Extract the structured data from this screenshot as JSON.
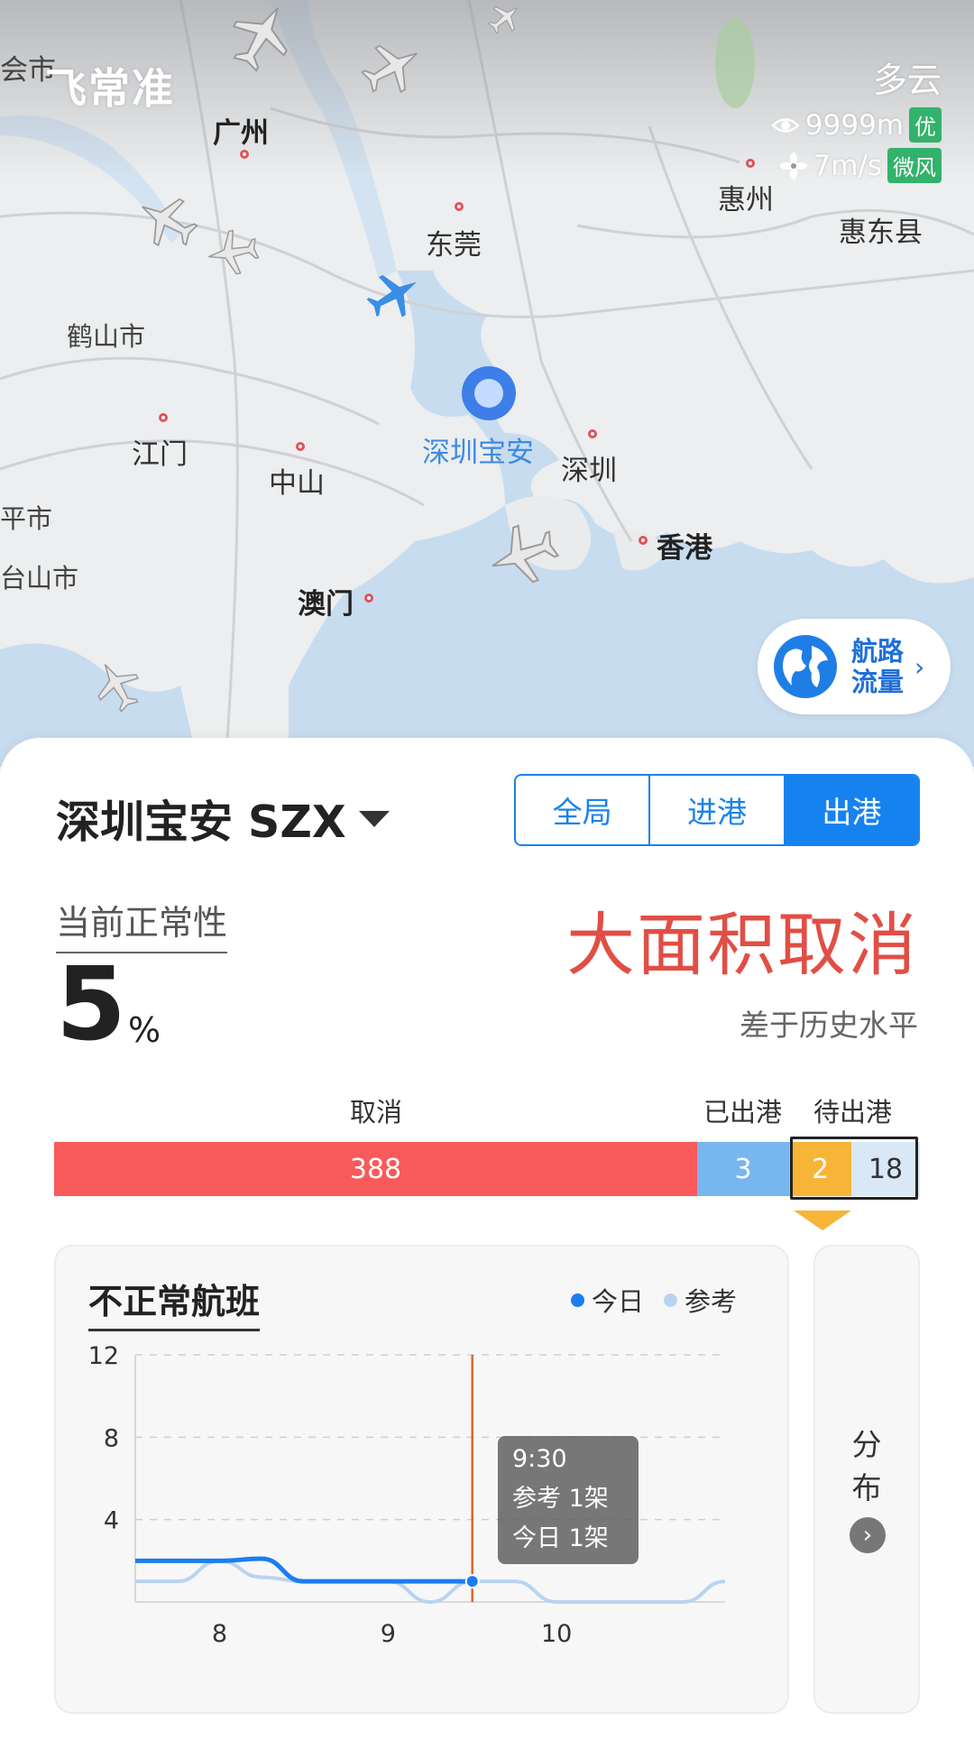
{
  "app": {
    "logo": "飞常准"
  },
  "weather": {
    "condition": "多云",
    "visibility": "9999m",
    "visibility_level": "优",
    "wind": "7m/s",
    "wind_level": "微风"
  },
  "map": {
    "cities": {
      "guangzhou": "广州",
      "dongguan": "东莞",
      "huizhou": "惠州",
      "huidong": "惠东县",
      "heshan": "鹤山市",
      "jiangmen": "江门",
      "zhongshan": "中山",
      "shenzhen": "深圳",
      "hongkong": "香港",
      "macau": "澳门",
      "kaiping": "平市",
      "taishan": "台山市",
      "huishi": "会市"
    },
    "airport_label": "深圳宝安",
    "route_button": {
      "line1": "航路",
      "line2": "流量"
    }
  },
  "panel": {
    "airport_title": "深圳宝安 SZX",
    "tabs": [
      "全局",
      "进港",
      "出港"
    ],
    "active_tab": "出港",
    "normality_label": "当前正常性",
    "normality_value": "5",
    "normality_unit": "%",
    "status": "大面积取消",
    "status_sub": "差于历史水平",
    "bar": {
      "labels": {
        "cancelled": "取消",
        "departed": "已出港",
        "pending": "待出港"
      },
      "values": {
        "cancelled": "388",
        "departed": "3",
        "pending_a": "2",
        "pending_b": "18"
      }
    },
    "abnormal": {
      "title": "不正常航班",
      "legend_today": "今日",
      "legend_ref": "参考",
      "tooltip": {
        "time": "9:30",
        "ref": "参考 1架",
        "today": "今日 1架"
      }
    },
    "side": {
      "line1": "分",
      "line2": "布",
      "arrow": "›"
    }
  },
  "colors": {
    "today": "#1a7ef0",
    "reference": "#b9d4f0",
    "cursor": "#e0642c",
    "cancel": "#f95a5a",
    "departed": "#77b6ee",
    "pending": "#f7b538"
  },
  "chart_data": {
    "type": "line",
    "x": [
      7.5,
      7.75,
      8.0,
      8.25,
      8.5,
      8.75,
      9.0,
      9.25,
      9.5,
      9.75,
      10.0,
      10.25,
      10.5,
      10.75,
      11.0
    ],
    "xticks": [
      "8",
      "9",
      "10"
    ],
    "xtick_values": [
      8,
      9,
      10
    ],
    "ylim": [
      0,
      12
    ],
    "yticks": [
      12,
      8,
      4
    ],
    "series": [
      {
        "name": "今日",
        "values": [
          2,
          2,
          2,
          2.1,
          1,
          1,
          1,
          1,
          1,
          null,
          null,
          null,
          null,
          null,
          null
        ]
      },
      {
        "name": "参考",
        "values": [
          1,
          1,
          2,
          1.2,
          1,
          1,
          1,
          0,
          1,
          1,
          0,
          0,
          0,
          0,
          1
        ]
      }
    ],
    "cursor_x": 9.5,
    "grid": "dashed-horizontal",
    "legend": "top-right"
  }
}
